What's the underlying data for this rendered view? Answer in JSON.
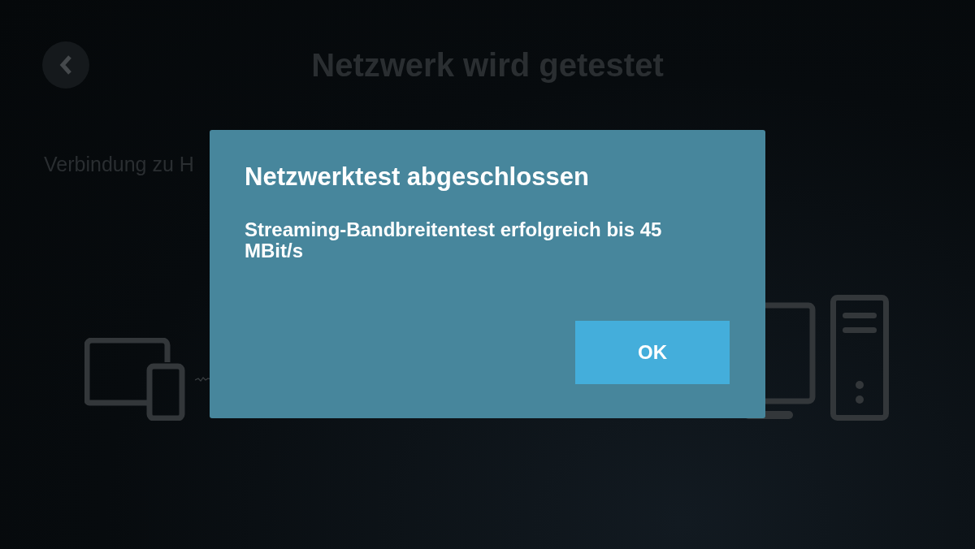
{
  "screen": {
    "title": "Netzwerk wird getestet",
    "subtitle": "Verbindung zu H"
  },
  "dialog": {
    "title": "Netzwerktest abgeschlossen",
    "message": "Streaming-Bandbreitentest erfolgreich bis 45 MBit/s",
    "buttons": [
      "OK"
    ]
  }
}
